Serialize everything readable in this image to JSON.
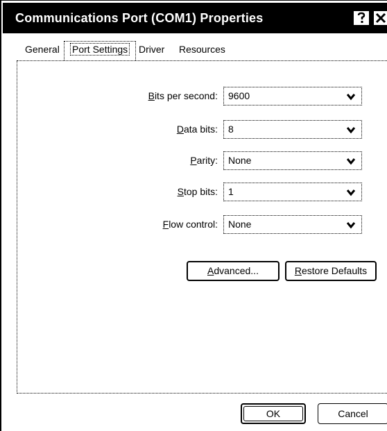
{
  "window": {
    "title": "Communications Port (COM1) Properties"
  },
  "tabs": [
    {
      "label": "General"
    },
    {
      "label": "Port Settings"
    },
    {
      "label": "Driver"
    },
    {
      "label": "Resources"
    }
  ],
  "fields": {
    "bits_per_second": {
      "label_u": "B",
      "label_rest": "its per second:",
      "value": "9600"
    },
    "data_bits": {
      "label_u": "D",
      "label_rest": "ata bits:",
      "value": "8"
    },
    "parity": {
      "label_pre": "",
      "label_u": "P",
      "label_rest": "arity:",
      "value": "None"
    },
    "stop_bits": {
      "label_u": "S",
      "label_rest": "top bits:",
      "value": "1"
    },
    "flow_control": {
      "label_u": "F",
      "label_rest": "low control:",
      "value": "None"
    }
  },
  "buttons": {
    "advanced": {
      "u": "A",
      "rest": "dvanced..."
    },
    "restore": {
      "u": "R",
      "rest": "estore Defaults"
    },
    "ok": "OK",
    "cancel": "Cancel"
  }
}
